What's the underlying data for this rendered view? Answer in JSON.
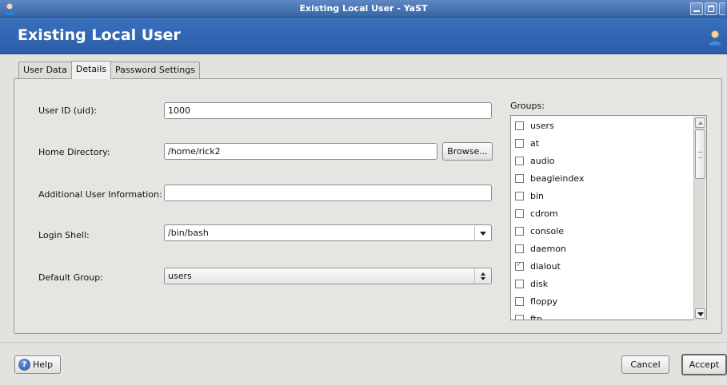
{
  "window": {
    "title": "Existing Local User - YaST",
    "heading": "Existing Local User"
  },
  "tabs": [
    {
      "label": "User Data",
      "active": false
    },
    {
      "label": "Details",
      "active": true
    },
    {
      "label": "Password Settings",
      "active": false
    }
  ],
  "form": {
    "uid_label": "User ID (uid):",
    "uid_value": "1000",
    "home_label": "Home Directory:",
    "home_value": "/home/rick2",
    "browse_label": "Browse...",
    "info_label": "Additional User Information:",
    "info_value": "",
    "shell_label": "Login Shell:",
    "shell_value": "/bin/bash",
    "group_label": "Default Group:",
    "group_value": "users"
  },
  "groups": {
    "label": "Groups:",
    "items": [
      {
        "name": "users",
        "checked": false
      },
      {
        "name": "at",
        "checked": false
      },
      {
        "name": "audio",
        "checked": false
      },
      {
        "name": "beagleindex",
        "checked": false
      },
      {
        "name": "bin",
        "checked": false
      },
      {
        "name": "cdrom",
        "checked": false
      },
      {
        "name": "console",
        "checked": false
      },
      {
        "name": "daemon",
        "checked": false
      },
      {
        "name": "dialout",
        "checked": true
      },
      {
        "name": "disk",
        "checked": false
      },
      {
        "name": "floppy",
        "checked": false
      },
      {
        "name": "ftp",
        "checked": false
      }
    ]
  },
  "buttons": {
    "help": "Help",
    "cancel": "Cancel",
    "accept": "Accept"
  },
  "colors": {
    "titlebar": "#3765a5",
    "header": "#2b5ea8",
    "panel": "#e6e5e2"
  }
}
